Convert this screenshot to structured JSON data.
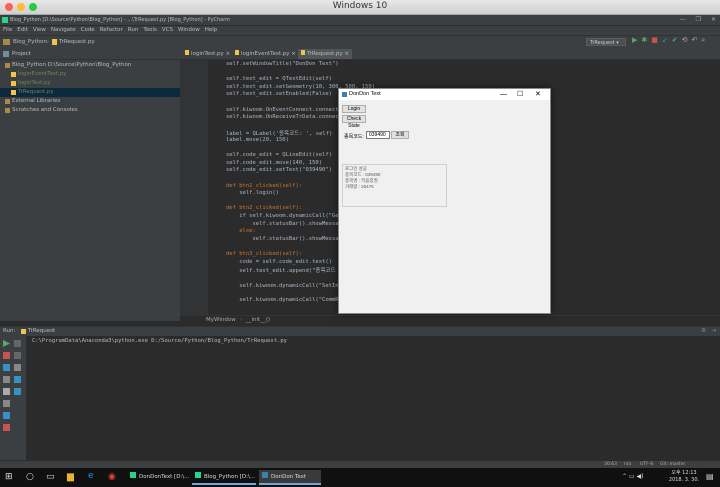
{
  "mac": {
    "title": "Windows 10"
  },
  "window": {
    "title": "Blog_Python [D:\\Source\\Python\\Blog_Python] - ...\\TrRequest.py [Blog_Python] - PyCharm"
  },
  "menu": [
    "File",
    "Edit",
    "View",
    "Navigate",
    "Code",
    "Refactor",
    "Run",
    "Tools",
    "VCS",
    "Window",
    "Help"
  ],
  "nav": {
    "project": "Blog_Python",
    "file": "TrRequest.py",
    "run_config": "TrRequest"
  },
  "project_panel": {
    "title": "Project",
    "tree": [
      {
        "label": "Blog_Python  D:\\Source\\Python\\Blog_Python",
        "indent": 1
      },
      {
        "label": "loginEventTest.py",
        "indent": 2
      },
      {
        "label": "loginTest.py",
        "indent": 2
      },
      {
        "label": "TrRequest.py",
        "indent": 2
      },
      {
        "label": "External Libraries",
        "indent": 1
      },
      {
        "label": "Scratches and Consoles",
        "indent": 1
      }
    ]
  },
  "tabs": [
    "loginTest.py",
    "loginEventTest.py",
    "TrRequest.py"
  ],
  "code_lines": [
    {
      "t": "self.setWindowTitle(\"DonDon Text\")",
      "c": "#a9b7c6"
    },
    {
      "t": "",
      "c": "#a9b7c6"
    },
    {
      "t": "self.text_edit = QTextEdit(self)",
      "c": "#a9b7c6"
    },
    {
      "t": "self.text_edit.setGeometry(10, 300, 500, 150)",
      "c": "#a9b7c6"
    },
    {
      "t": "self.text_edit.setEnabled(False)",
      "c": "#a9b7c6"
    },
    {
      "t": "",
      "c": "#a9b7c6"
    },
    {
      "t": "self.kiwoom.OnEventConnect.connect(self.event_connect)",
      "c": "#a9b7c6"
    },
    {
      "t": "self.kiwoom.OnReceiveTrData.connect(self.receive_trdata)",
      "c": "#a9b7c6"
    },
    {
      "t": "",
      "c": "#a9b7c6"
    },
    {
      "t": "label = QLabel('종목코드: ', self)",
      "c": "#a9b7c6"
    },
    {
      "t": "label.move(20, 150)",
      "c": "#a9b7c6"
    },
    {
      "t": "",
      "c": "#a9b7c6"
    },
    {
      "t": "self.code_edit = QLineEdit(self)",
      "c": "#a9b7c6"
    },
    {
      "t": "self.code_edit.move(140, 150)",
      "c": "#a9b7c6"
    },
    {
      "t": "self.code_edit.setText(\"039490\")",
      "c": "#a9b7c6"
    },
    {
      "t": "",
      "c": "#a9b7c6"
    },
    {
      "t": "def btn1_clicked(self):",
      "c": "#cc7832"
    },
    {
      "t": "    self.login()",
      "c": "#a9b7c6"
    },
    {
      "t": "",
      "c": "#a9b7c6"
    },
    {
      "t": "def btn2_clicked(self):",
      "c": "#cc7832"
    },
    {
      "t": "    if self.kiwoom.dynamicCall(\"GetConnectState()\") == 0:",
      "c": "#a9b7c6"
    },
    {
      "t": "        self.statusBar().showMessage(\"Not Connected\")",
      "c": "#a9b7c6"
    },
    {
      "t": "    else:",
      "c": "#cc7832"
    },
    {
      "t": "        self.statusBar().showMessage(\"Connected\")",
      "c": "#a9b7c6"
    },
    {
      "t": "",
      "c": "#a9b7c6"
    },
    {
      "t": "def btn3_clicked(self):",
      "c": "#cc7832"
    },
    {
      "t": "    code = self.code_edit.text()",
      "c": "#a9b7c6"
    },
    {
      "t": "    self.text_edit.append(\"종목코드 : \" + code)",
      "c": "#a9b7c6"
    },
    {
      "t": "",
      "c": "#a9b7c6"
    },
    {
      "t": "    self.kiwoom.dynamicCall(\"SetInputValue(QString, QString)\", \"종목코드\", code)",
      "c": "#a9b7c6"
    },
    {
      "t": "",
      "c": "#a9b7c6"
    },
    {
      "t": "    self.kiwoom.dynamicCall(\"CommRqData(QString, QString, int, QString)\", ...)",
      "c": "#a9b7c6"
    }
  ],
  "breadcrumb": {
    "cls": "MyWindow",
    "fn": "__init__()"
  },
  "run": {
    "title": "Run:",
    "tab": "TrRequest",
    "output": "C:\\ProgramData\\Anaconda3\\python.exe D:/Source/Python/Blog_Python/TrRequest.py"
  },
  "statusbar": {
    "pos": "30:63",
    "sep": "n/a",
    "enc": "UTF-8",
    "git": "Git: master"
  },
  "dialog": {
    "title": "DonDon Text",
    "login_btn": "Login",
    "check_btn": "Check State",
    "code_label": "종목코드:",
    "code_value": "039490",
    "query_btn": "조회",
    "log": [
      "로그인 성공",
      "종목코드 : 039490",
      "종목명 : 키움증권",
      "거래량 : 25476"
    ]
  },
  "taskbar": {
    "items": [
      "DonDonText [D:\\...",
      "Blog_Python [D:\\...",
      "DonDon Text"
    ],
    "time": "오후 12:13",
    "date": "2018. 3. 30."
  }
}
